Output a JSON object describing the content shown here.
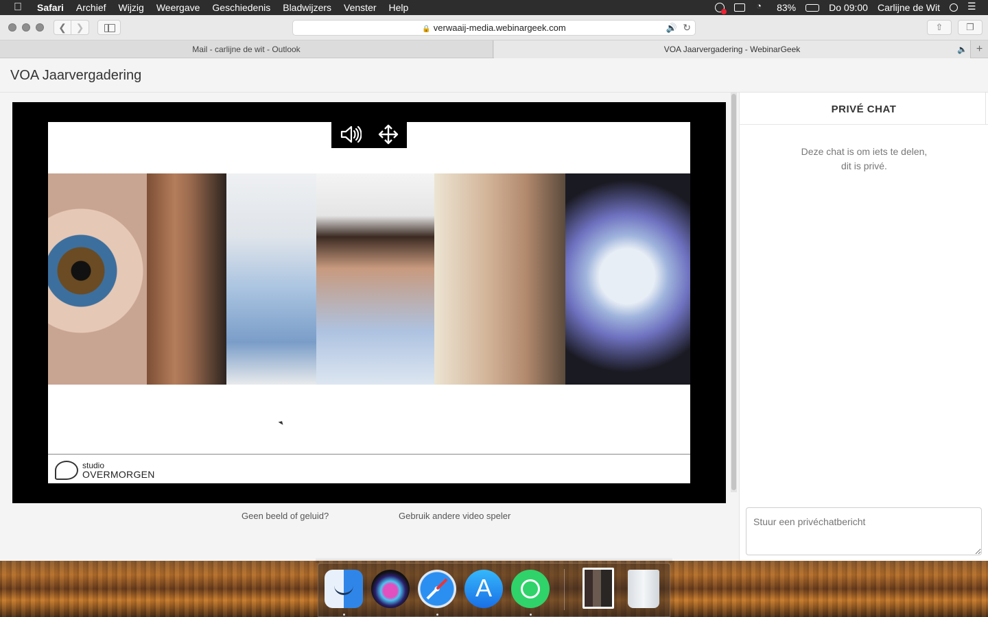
{
  "menubar": {
    "app_name": "Safari",
    "menus": [
      "Archief",
      "Wijzig",
      "Weergave",
      "Geschiedenis",
      "Bladwijzers",
      "Venster",
      "Help"
    ],
    "battery": "83%",
    "clock": "Do 09:00",
    "user": "Carlijne de Wit"
  },
  "toolbar": {
    "url": "verwaaij-media.webinargeek.com"
  },
  "tabs": [
    {
      "label": "Mail - carlijne de wit - Outlook"
    },
    {
      "label": "VOA Jaarvergadering - WebinarGeek"
    }
  ],
  "page": {
    "title": "VOA Jaarvergadering",
    "slide_logo": {
      "line1": "studio",
      "line2": "OVERMORGEN"
    },
    "help_links": {
      "no_picture": "Geen beeld of geluid?",
      "other_player": "Gebruik andere video speler"
    }
  },
  "chat": {
    "title": "PRIVÉ CHAT",
    "note_line1": "Deze chat is om iets te delen,",
    "note_line2": "dit is privé.",
    "input_placeholder": "Stuur een privéchatbericht"
  },
  "dock": {
    "apps": [
      "finder-icon",
      "siri-icon",
      "safari-icon",
      "app-store-icon",
      "whatsapp-icon",
      "photo-icon",
      "trash-icon"
    ]
  }
}
